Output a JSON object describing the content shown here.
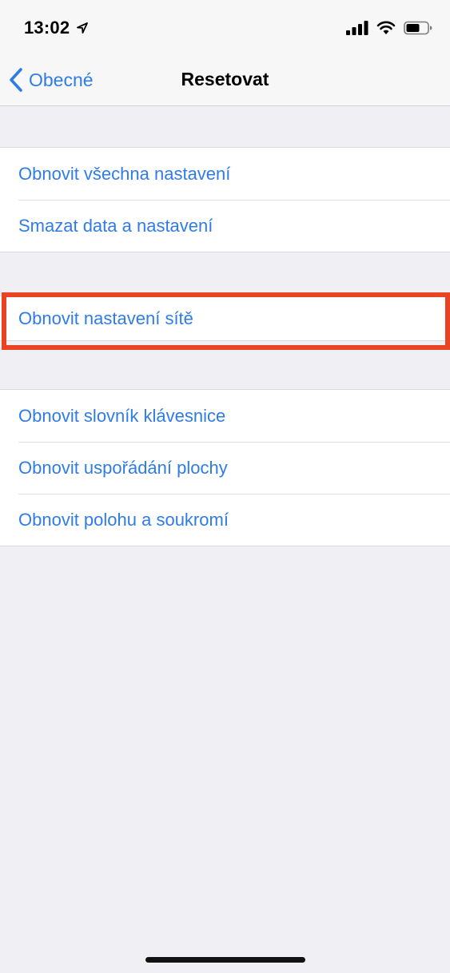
{
  "status_bar": {
    "time": "13:02",
    "icons": [
      "location-arrow-icon",
      "cellular-signal-icon",
      "wifi-icon",
      "battery-icon"
    ]
  },
  "nav": {
    "back_label": "Obecné",
    "title": "Resetovat"
  },
  "groups": [
    {
      "items": [
        {
          "label": "Obnovit všechna nastavení"
        },
        {
          "label": "Smazat data a nastavení"
        }
      ]
    },
    {
      "items": [
        {
          "label": "Obnovit nastavení sítě",
          "highlighted": true
        }
      ]
    },
    {
      "items": [
        {
          "label": "Obnovit slovník klávesnice"
        },
        {
          "label": "Obnovit uspořádání plochy"
        },
        {
          "label": "Obnovit polohu a soukromí"
        }
      ]
    }
  ],
  "colors": {
    "accent": "#2f7ce6",
    "highlight": "#ea4323",
    "background": "#efeff4"
  }
}
